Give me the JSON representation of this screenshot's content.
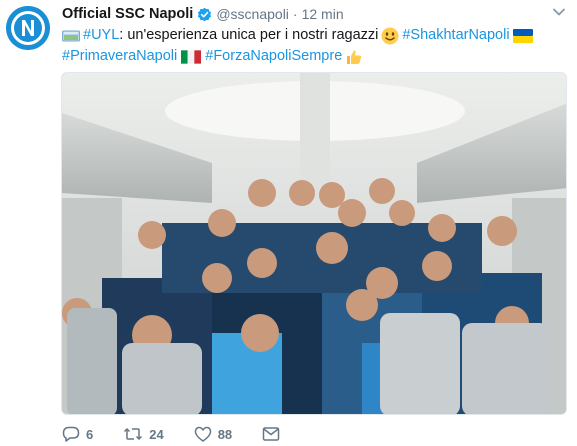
{
  "account": {
    "name": "Official SSC Napoli",
    "handle": "@sscnapoli",
    "separator": "·",
    "time": "12 min"
  },
  "tweet": {
    "line1": {
      "tag1": "#UYL",
      "text1": ": un'esperienza unica per i nostri ragazzi",
      "tag2": "#ShakhtarNapoli"
    },
    "line2": {
      "tag1": "#PrimaveraNapoli",
      "tag2": "#ForzaNapoliSempre"
    }
  },
  "actions": {
    "replies": "6",
    "retweets": "24",
    "likes": "88"
  },
  "colors": {
    "hashtag": "#1b95e0",
    "muted": "#657786",
    "napoli_blue": "#1a8fd6"
  },
  "icons": [
    "verified-badge-icon",
    "caret-down-icon",
    "reply-icon",
    "retweet-icon",
    "like-icon",
    "dm-icon"
  ]
}
